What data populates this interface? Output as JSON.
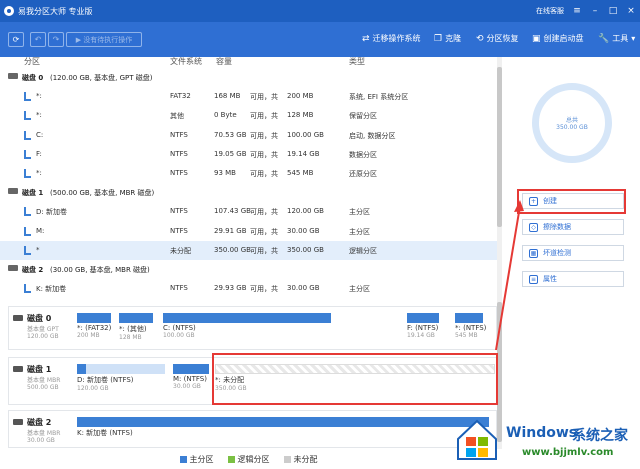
{
  "app": {
    "title": "易我分区大师 专业版",
    "online_support": "在线客服"
  },
  "toolbar": {
    "execute_label": "没有待执行操作",
    "tools": [
      {
        "label": "迁移操作系统",
        "icon": "migrate-icon"
      },
      {
        "label": "克隆",
        "icon": "clone-icon"
      },
      {
        "label": "分区恢复",
        "icon": "recovery-icon"
      },
      {
        "label": "创建启动盘",
        "icon": "bootdisk-icon"
      },
      {
        "label": "工具",
        "icon": "wrench-icon"
      }
    ]
  },
  "columns": [
    "分区",
    "文件系统",
    "容量",
    "类型"
  ],
  "list": [
    {
      "kind": "disk",
      "name": "磁盘 0",
      "info": "(120.00 GB, 基本盘, GPT 磁盘)"
    },
    {
      "kind": "part",
      "name": "*:",
      "fs": "FAT32",
      "used": "168 MB",
      "sep": "可用，共",
      "total": "200 MB",
      "type": "系统, EFI 系统分区"
    },
    {
      "kind": "part",
      "name": "*:",
      "fs": "其他",
      "used": "0 Byte",
      "sep": "可用，共",
      "total": "128 MB",
      "type": "保留分区"
    },
    {
      "kind": "part",
      "name": "C:",
      "fs": "NTFS",
      "used": "70.53 GB",
      "sep": "可用，共",
      "total": "100.00 GB",
      "type": "启动, 数据分区"
    },
    {
      "kind": "part",
      "name": "F:",
      "fs": "NTFS",
      "used": "19.05 GB",
      "sep": "可用，共",
      "total": "19.14 GB",
      "type": "数据分区"
    },
    {
      "kind": "part",
      "name": "*:",
      "fs": "NTFS",
      "used": "93 MB",
      "sep": "可用，共",
      "total": "545 MB",
      "type": "还原分区"
    },
    {
      "kind": "disk",
      "name": "磁盘 1",
      "info": "(500.00 GB, 基本盘, MBR 磁盘)"
    },
    {
      "kind": "part",
      "name": "D: 新加卷",
      "fs": "NTFS",
      "used": "107.43 GB",
      "sep": "可用，共",
      "total": "120.00 GB",
      "type": "主分区"
    },
    {
      "kind": "part",
      "name": "M:",
      "fs": "NTFS",
      "used": "29.91 GB",
      "sep": "可用，共",
      "total": "30.00 GB",
      "type": "主分区"
    },
    {
      "kind": "part",
      "name": "*",
      "fs": "未分配",
      "used": "350.00 GB",
      "sep": "可用，共",
      "total": "350.00 GB",
      "type": "逻辑分区",
      "selected": true
    },
    {
      "kind": "disk",
      "name": "磁盘 2",
      "info": "(30.00 GB, 基本盘, MBR 磁盘)"
    },
    {
      "kind": "part",
      "name": "K: 新加卷",
      "fs": "NTFS",
      "used": "29.93 GB",
      "sep": "可用，共",
      "total": "30.00 GB",
      "type": "主分区"
    }
  ],
  "maps": [
    {
      "name": "磁盘 0",
      "sub1": "基本盘 GPT",
      "sub2": "120.00 GB",
      "segs": [
        {
          "name": "*: (FAT32)",
          "size": "200 MB"
        },
        {
          "name": "*: (其他)",
          "size": "128 MB"
        },
        {
          "name": "C: (NTFS)",
          "size": "100.00 GB"
        },
        {
          "name": "F: (NTFS)",
          "size": "19.14 GB"
        },
        {
          "name": "*: (NTFS)",
          "size": "545 MB"
        }
      ]
    },
    {
      "name": "磁盘 1",
      "sub1": "基本盘 MBR",
      "sub2": "500.00 GB",
      "segs": [
        {
          "name": "D: 新加卷 (NTFS)",
          "size": "120.00 GB"
        },
        {
          "name": "M: (NTFS)",
          "size": "30.00 GB"
        },
        {
          "name": "*: 未分配",
          "size": "350.00 GB"
        }
      ]
    },
    {
      "name": "磁盘 2",
      "sub1": "基本盘 MBR",
      "sub2": "30.00 GB",
      "segs": [
        {
          "name": "K: 新加卷 (NTFS)",
          "size": ""
        }
      ]
    }
  ],
  "summary": {
    "label": "总共",
    "value": "350.00 GB"
  },
  "actions": [
    "创建",
    "擦除数据",
    "坏道检测",
    "属性"
  ],
  "legend": [
    {
      "label": "主分区",
      "color": "#3b7fd4"
    },
    {
      "label": "逻辑分区",
      "color": "#7bc043"
    },
    {
      "label": "未分配",
      "color": "#cccccc"
    }
  ],
  "watermark": {
    "brand": "Windows",
    "site": "系统之家",
    "url": "www.bjjmlv.com"
  },
  "colors": {
    "titlebar": "#1e5fc0",
    "toolbar": "#2f6fd3",
    "accent": "#3b7fd4",
    "highlight": "#e53935"
  }
}
